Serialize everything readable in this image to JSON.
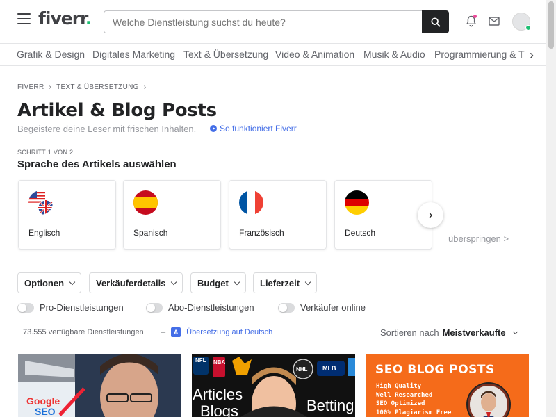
{
  "header": {
    "logo_text": "fiverr",
    "logo_dot": ".",
    "search_placeholder": "Welche Dienstleistung suchst du heute?"
  },
  "categories": [
    "Grafik & Design",
    "Digitales Marketing",
    "Text & Übersetzung",
    "Video & Animation",
    "Musik & Audio",
    "Programmierung & T"
  ],
  "breadcrumb": {
    "home": "FIVERR",
    "section": "TEXT & ÜBERSETZUNG"
  },
  "page": {
    "title": "Artikel & Blog Posts",
    "subtitle": "Begeistere deine Leser mit frischen Inhalten.",
    "how_link": "So funktioniert Fiverr"
  },
  "step": {
    "label": "SCHRITT 1 VON 2",
    "title": "Sprache des Artikels auswählen"
  },
  "languages": [
    {
      "name": "Englisch"
    },
    {
      "name": "Spanisch"
    },
    {
      "name": "Französisch"
    },
    {
      "name": "Deutsch"
    }
  ],
  "skip_label": "überspringen >",
  "filters": [
    "Optionen",
    "Verkäuferdetails",
    "Budget",
    "Lieferzeit"
  ],
  "toggles": [
    "Pro-Dienstleistungen",
    "Abo-Dienstleistungen",
    "Verkäufer online"
  ],
  "results": {
    "count": "73.555 verfügbare Dienstleistungen",
    "separator": "–",
    "translate_icon": "A",
    "translate_link": "Übersetzung auf Deutsch",
    "sort_label": "Sortieren nach",
    "sort_value": "Meistverkaufte"
  },
  "gigs": [
    {
      "label": "Google",
      "sub": "SEO"
    },
    {
      "text1": "Articles",
      "text2": "Blogs",
      "text3": "Betting",
      "badge_nfl": "NFL",
      "badge_nba": "NBA",
      "badge_nhl": "NHL",
      "badge_mlb": "MLB"
    },
    {
      "title": "SEO BLOG POSTS",
      "lines": [
        "High Quality",
        "Well Researched",
        "SEO Optimized",
        "100% Plagiarism Free"
      ]
    }
  ]
}
